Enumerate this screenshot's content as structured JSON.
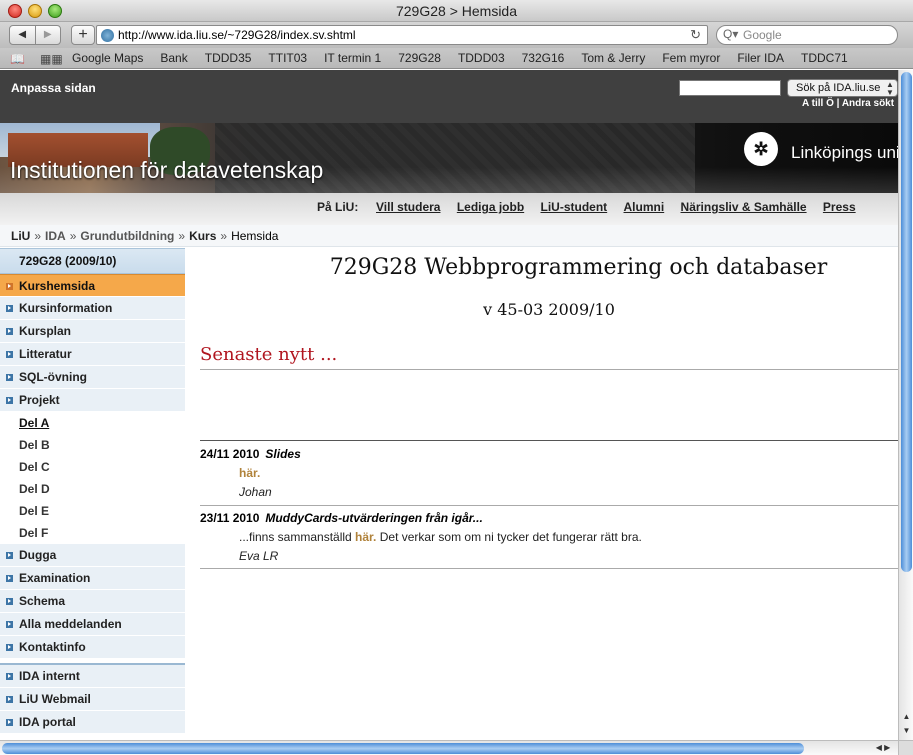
{
  "window": {
    "title": "729G28 > Hemsida"
  },
  "toolbar": {
    "back_icon": "◀",
    "forward_icon": "▶",
    "add_icon": "+",
    "url": "http://www.ida.liu.se/~729G28/index.sv.shtml",
    "reload_icon": "↻",
    "search_placeholder": "Google",
    "search_icon": "Q▾"
  },
  "bookmarks": {
    "items": [
      "Google Maps",
      "Bank",
      "TDDD35",
      "TTIT03",
      "IT termin 1",
      "729G28",
      "TDDD03",
      "732G16",
      "Tom & Jerry",
      "Fem myror",
      "Filer IDA",
      "TDDC71"
    ]
  },
  "site": {
    "anpassa": "Anpassa sidan",
    "search_select": "Sök på IDA.liu.se",
    "top_links": "A till Ö  |  Andra sökt",
    "banner_title": "Institutionen för datavetenskap",
    "liu_name": "Linköpings uni",
    "paliu_label": "På LiU:",
    "paliu_links": [
      "Vill studera",
      "Lediga jobb",
      "LiU-student",
      "Alumni",
      "Näringsliv & Samhälle",
      "Press"
    ]
  },
  "breadcrumb": {
    "items": [
      "LiU",
      "IDA",
      "Grundutbildning",
      "Kurs"
    ],
    "current": "Hemsida",
    "separator": "»"
  },
  "sidebar": {
    "head": "729G28 (2009/10)",
    "items": [
      "Kurshemsida",
      "Kursinformation",
      "Kursplan",
      "Litteratur",
      "SQL-övning",
      "Projekt"
    ],
    "sub_items": [
      "Del A",
      "Del B",
      "Del C",
      "Del D",
      "Del E",
      "Del F"
    ],
    "items2": [
      "Dugga",
      "Examination",
      "Schema",
      "Alla meddelanden",
      "Kontaktinfo"
    ],
    "items3": [
      "IDA internt",
      "LiU Webmail",
      "IDA portal"
    ]
  },
  "main": {
    "title": "729G28 Webbprogrammering och databaser",
    "week": "v 45-03 2009/10",
    "news_heading": "Senaste nytt ...",
    "news": [
      {
        "date": "24/11 2010",
        "title": "Slides",
        "body_pre": "",
        "link": "här.",
        "body_post": "",
        "author": "Johan"
      },
      {
        "date": "23/11 2010",
        "title": "MuddyCards-utvärderingen från igår...",
        "body_pre": "...finns sammanställd ",
        "link": "här.",
        "body_post": " Det verkar som om ni tycker det fungerar rätt bra.",
        "author": "Eva LR"
      }
    ]
  },
  "colors": {
    "accent_orange": "#f5a84a",
    "news_red": "#b0141e",
    "link_brown": "#b0823a",
    "sidebar_blue": "#e9f0f6"
  }
}
